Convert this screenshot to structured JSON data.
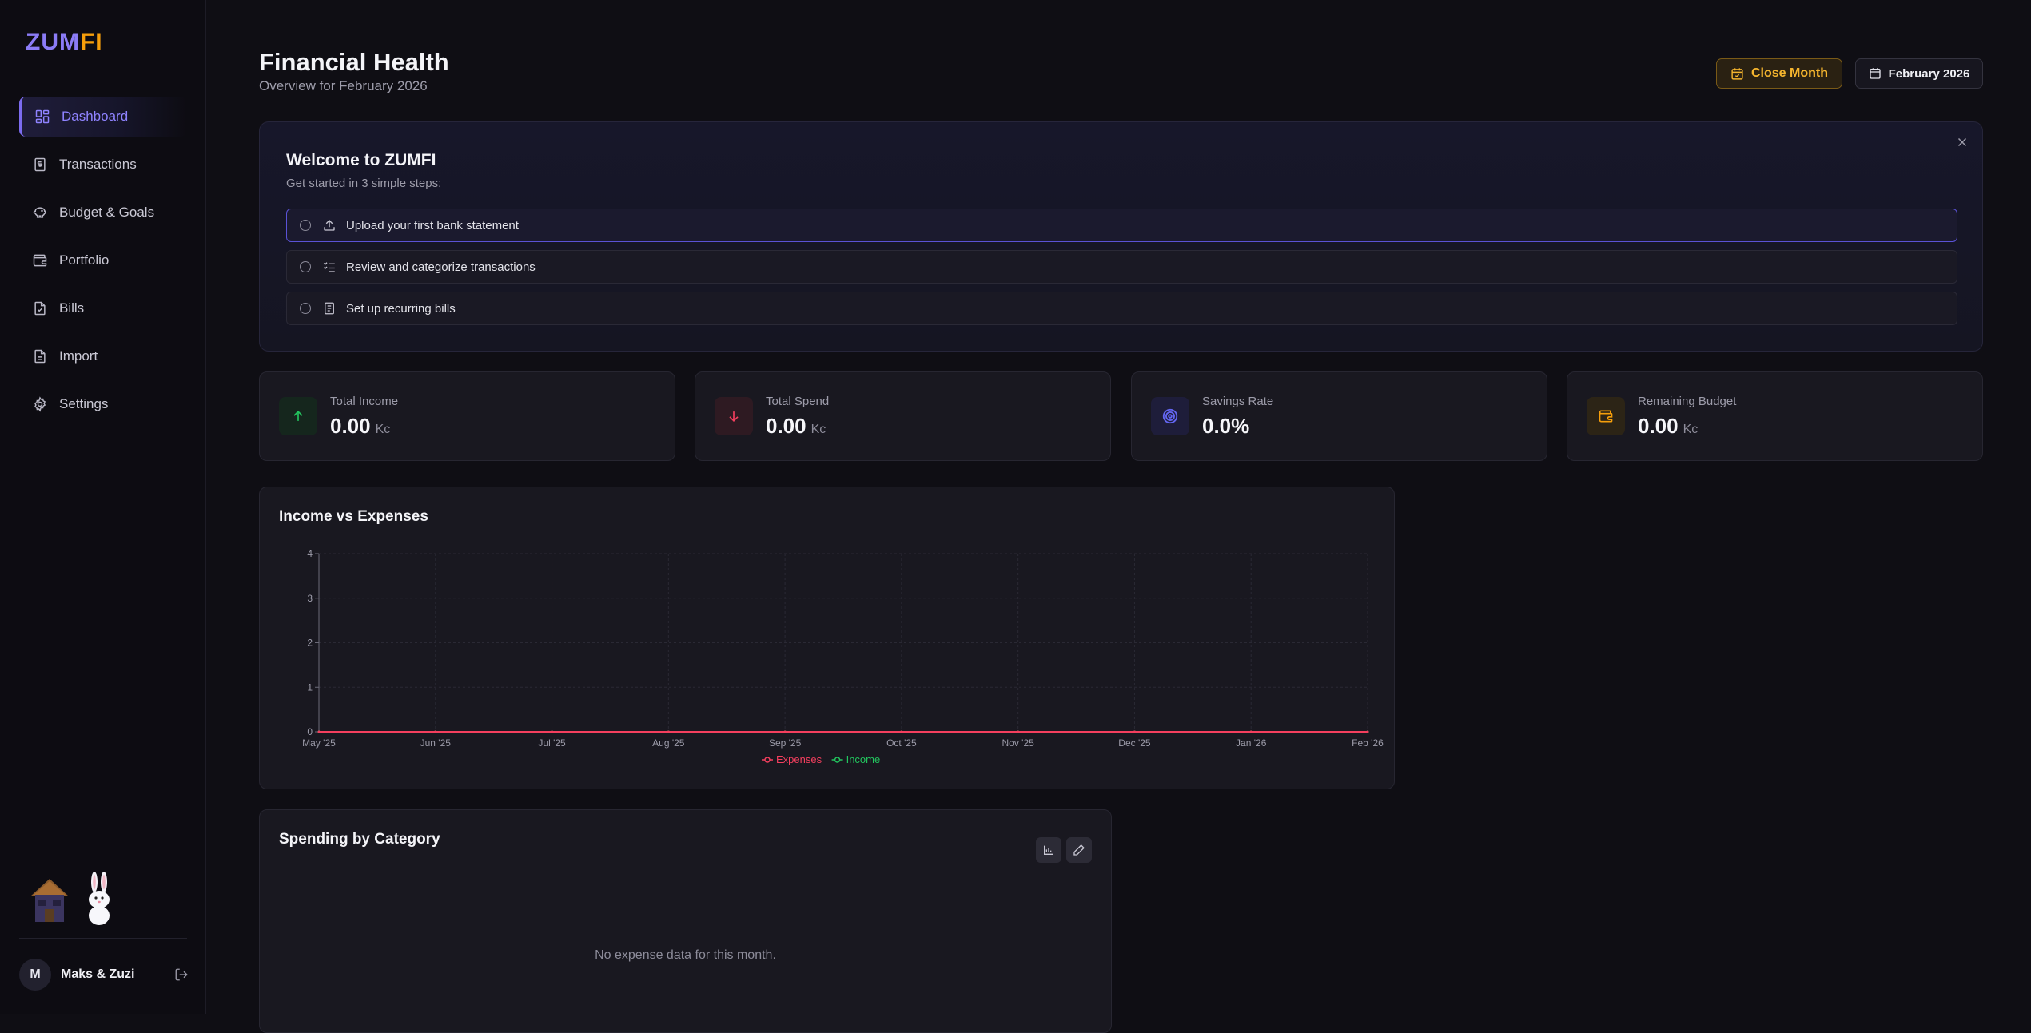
{
  "brand": {
    "logo_part1": "ZUM",
    "logo_part2": "FI"
  },
  "sidebar": {
    "items": [
      {
        "label": "Dashboard",
        "icon": "dashboard-icon",
        "active": true
      },
      {
        "label": "Transactions",
        "icon": "receipt-icon"
      },
      {
        "label": "Budget & Goals",
        "icon": "piggy-bank-icon"
      },
      {
        "label": "Portfolio",
        "icon": "wallet-icon"
      },
      {
        "label": "Bills",
        "icon": "document-icon"
      },
      {
        "label": "Import",
        "icon": "file-import-icon"
      },
      {
        "label": "Settings",
        "icon": "gear-icon"
      }
    ],
    "user": {
      "initial": "M",
      "name": "Maks & Zuzi"
    }
  },
  "header": {
    "title": "Financial Health",
    "subtitle": "Overview for February 2026",
    "close_month_label": "Close Month",
    "month_label": "February 2026"
  },
  "welcome": {
    "title": "Welcome to ZUMFI",
    "subtitle": "Get started in 3 simple steps:",
    "steps": [
      {
        "label": "Upload your first bank statement",
        "icon": "upload-icon"
      },
      {
        "label": "Review and categorize transactions",
        "icon": "checklist-icon"
      },
      {
        "label": "Set up recurring bills",
        "icon": "bill-icon"
      }
    ]
  },
  "stats": [
    {
      "label": "Total Income",
      "value": "0.00",
      "unit": "Kc",
      "icon": "arrow-up-icon",
      "color": "#22c55e"
    },
    {
      "label": "Total Spend",
      "value": "0.00",
      "unit": "Kc",
      "icon": "arrow-down-icon",
      "color": "#f43f5e"
    },
    {
      "label": "Savings Rate",
      "value": "0.0%",
      "unit": "",
      "icon": "target-icon",
      "color": "#6366f1"
    },
    {
      "label": "Remaining Budget",
      "value": "0.00",
      "unit": "Kc",
      "icon": "wallet-icon",
      "color": "#f59e0b"
    }
  ],
  "income_chart": {
    "title": "Income vs Expenses",
    "legend": {
      "expenses": "Expenses",
      "income": "Income"
    }
  },
  "spending": {
    "title": "Spending by Category",
    "empty_message": "No expense data for this month."
  },
  "chart_data": {
    "type": "line",
    "title": "Income vs Expenses",
    "x": [
      "May '25",
      "Jun '25",
      "Jul '25",
      "Aug '25",
      "Sep '25",
      "Oct '25",
      "Nov '25",
      "Dec '25",
      "Jan '26",
      "Feb '26"
    ],
    "y_ticks": [
      0,
      1,
      2,
      3,
      4
    ],
    "ylim": [
      0,
      4
    ],
    "grid": true,
    "legend_position": "bottom",
    "series": [
      {
        "name": "Expenses",
        "color": "#f43f5e",
        "values": [
          0,
          0,
          0,
          0,
          0,
          0,
          0,
          0,
          0,
          0
        ]
      },
      {
        "name": "Income",
        "color": "#22c55e",
        "values": [
          0,
          0,
          0,
          0,
          0,
          0,
          0,
          0,
          0,
          0
        ]
      }
    ]
  }
}
